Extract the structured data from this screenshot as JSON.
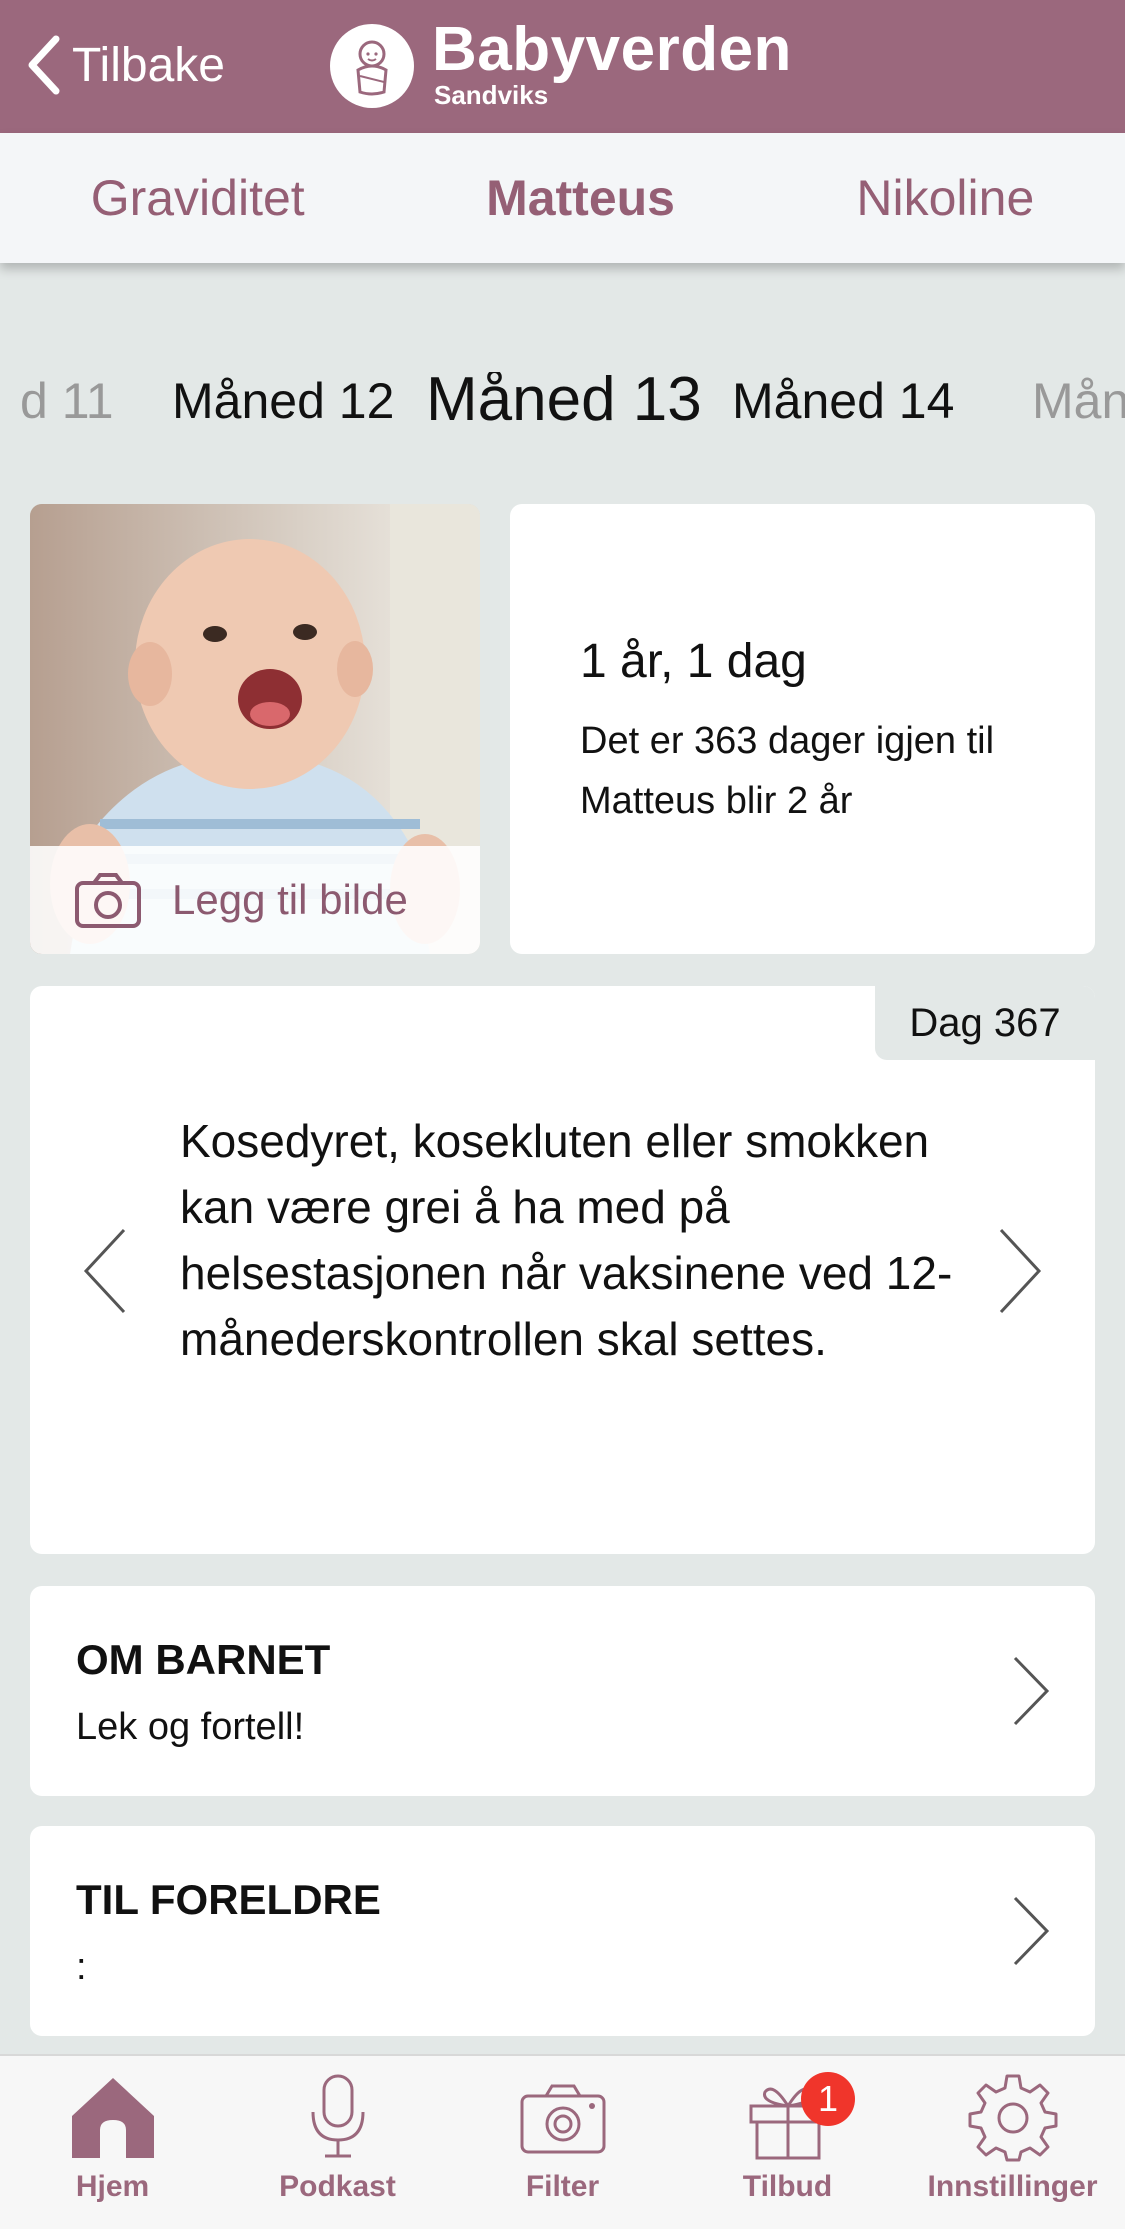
{
  "header": {
    "back_label": "Tilbake",
    "brand_title": "Babyverden",
    "brand_subtitle": "Sandviks"
  },
  "child_tabs": [
    {
      "label": "Graviditet",
      "active": false
    },
    {
      "label": "Matteus",
      "active": true
    },
    {
      "label": "Nikoline",
      "active": false
    }
  ],
  "months": {
    "partial_left": "d 11",
    "prev": "Måned 12",
    "current": "Måned 13",
    "next": "Måned 14",
    "partial_right": "Mån"
  },
  "photo_card": {
    "add_photo_label": "Legg til bilde"
  },
  "age_card": {
    "title": "1 år, 1 dag",
    "text": "Det er 363 dager igjen til Matteus blir 2 år"
  },
  "tip_card": {
    "day_label": "Dag 367",
    "text": "Kosedyret, kosekluten eller smokken kan være grei å ha med på helsestasjonen når vaksinene ved 12-månederskontrollen skal settes."
  },
  "sections": [
    {
      "title": "OM BARNET",
      "subtitle": "Lek og fortell!"
    },
    {
      "title": "TIL FORELDRE",
      "subtitle": ":"
    }
  ],
  "bottom_nav": {
    "items": [
      {
        "label": "Hjem",
        "icon": "home-icon",
        "active": true
      },
      {
        "label": "Podkast",
        "icon": "microphone-icon",
        "active": false
      },
      {
        "label": "Filter",
        "icon": "camera-icon",
        "active": false
      },
      {
        "label": "Tilbud",
        "icon": "gift-icon",
        "active": false
      },
      {
        "label": "Innstillinger",
        "icon": "gear-icon",
        "active": false
      }
    ],
    "tilbud_badge": "1"
  },
  "colors": {
    "brand": "#9b687d",
    "accent_text": "#955f75",
    "background": "#e3e8e7",
    "badge": "#f0352b"
  }
}
